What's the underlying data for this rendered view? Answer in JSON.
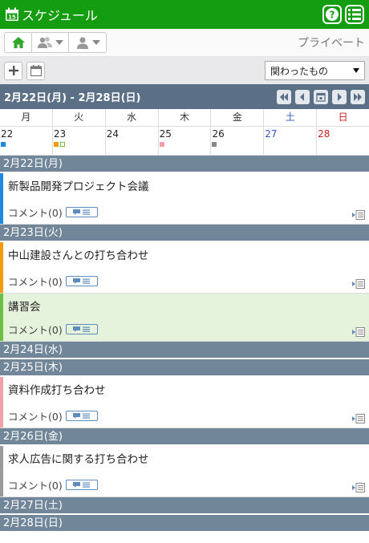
{
  "header": {
    "title": "スケジュール",
    "calendar_icon": "calendar-icon",
    "calendar_day": "15",
    "help_icon": "help-icon",
    "menu_icon": "list-menu-icon"
  },
  "viewbar": {
    "mode_label": "プライベート"
  },
  "actions": {
    "filter_value": "関わったもの"
  },
  "range": {
    "title": "2月22日(月) - 2月28日(日)"
  },
  "week_header": [
    "月",
    "火",
    "水",
    "木",
    "金",
    "土",
    "日"
  ],
  "week_days": [
    {
      "num": "22",
      "marks": [
        "#1e88e5"
      ]
    },
    {
      "num": "23",
      "marks": [
        "#f39c12",
        "hollow"
      ]
    },
    {
      "num": "24",
      "marks": []
    },
    {
      "num": "25",
      "marks": [
        "#f4a0a8"
      ]
    },
    {
      "num": "26",
      "marks": [
        "#888888"
      ]
    },
    {
      "num": "27",
      "marks": []
    },
    {
      "num": "28",
      "marks": []
    }
  ],
  "colors": {
    "header_bg": "#149d10",
    "range_bg": "#5b6f86",
    "day_bar_bg": "#72869a",
    "highlight_bg": "#e5f2dc"
  },
  "days": [
    {
      "label": "2月22日(月)",
      "events": [
        {
          "title": "新製品開発プロジェクト会議",
          "comment": "コメント(0)",
          "color": "#1e88e5",
          "highlight": false
        }
      ]
    },
    {
      "label": "2月23日(火)",
      "events": [
        {
          "title": "中山建設さんとの打ち合わせ",
          "comment": "コメント(0)",
          "color": "#f39c12",
          "highlight": false
        },
        {
          "title": "講習会",
          "comment": "コメント(0)",
          "color": "#6ac041",
          "highlight": true
        }
      ]
    },
    {
      "label": "2月24日(水)",
      "events": []
    },
    {
      "label": "2月25日(木)",
      "events": [
        {
          "title": "資料作成打ち合わせ",
          "comment": "コメント(0)",
          "color": "#f4a0a8",
          "highlight": false
        }
      ]
    },
    {
      "label": "2月26日(金)",
      "events": [
        {
          "title": "求人広告に関する打ち合わせ",
          "comment": "コメント(0)",
          "color": "#999999",
          "highlight": false
        }
      ]
    },
    {
      "label": "2月27日(土)",
      "events": []
    },
    {
      "label": "2月28日(日)",
      "events": []
    }
  ]
}
